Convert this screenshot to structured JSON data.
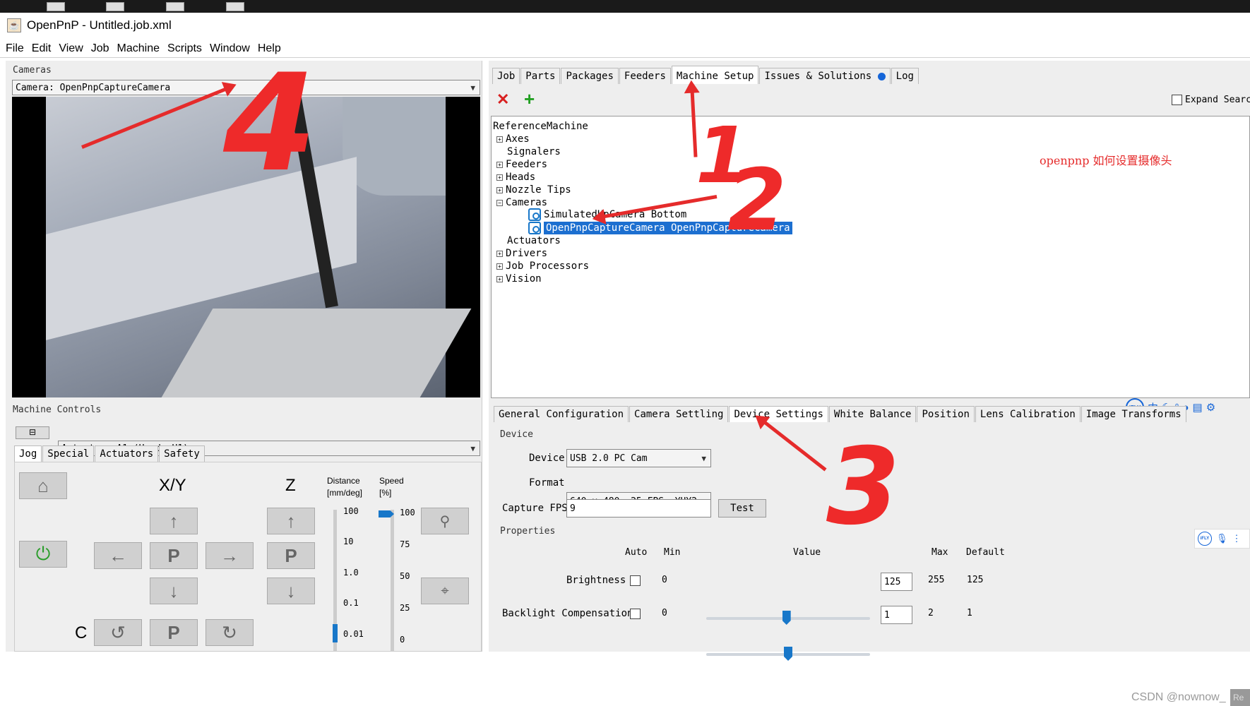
{
  "window": {
    "title": "OpenPnP - Untitled.job.xml"
  },
  "menu": [
    "File",
    "Edit",
    "View",
    "Job",
    "Machine",
    "Scripts",
    "Window",
    "Help"
  ],
  "cameras_panel": {
    "title": "Cameras",
    "selected_camera": "Camera: OpenPnpCaptureCamera"
  },
  "machine_controls": {
    "title": "Machine Controls",
    "actuator": "Actuator: A1 (Head: H1)",
    "tabs": [
      "Jog",
      "Special",
      "Actuators",
      "Safety"
    ],
    "xy_label": "X/Y",
    "z_label": "Z",
    "c_label": "C",
    "park_label": "P",
    "distance_label": "Distance",
    "distance_unit": "[mm/deg]",
    "speed_label": "Speed",
    "speed_unit": "[%]",
    "distance_ticks": [
      "100",
      "10",
      "1.0",
      "0.1",
      "0.01"
    ],
    "speed_ticks": [
      "100",
      "75",
      "50",
      "25",
      "0"
    ],
    "speed_value_pct": 100,
    "distance_value": 0.01
  },
  "top_tabs": [
    "Job",
    "Parts",
    "Packages",
    "Feeders",
    "Machine Setup",
    "Issues & Solutions",
    "Log"
  ],
  "top_active_tab": "Machine Setup",
  "toolbar": {
    "delete_icon": "x-icon",
    "add_icon": "plus-icon",
    "expand_search_label": "Expand Searc"
  },
  "tree": {
    "root": "ReferenceMachine",
    "items": [
      "Axes",
      "Signalers",
      "Feeders",
      "Heads",
      "Nozzle Tips",
      "Cameras",
      "Actuators",
      "Drivers",
      "Job Processors",
      "Vision"
    ],
    "cameras": [
      "SimulatedUpCamera Bottom",
      "OpenPnpCaptureCamera OpenPnpCaptureCamera"
    ],
    "selected": "OpenPnpCaptureCamera OpenPnpCaptureCamera"
  },
  "annotation_text": "openpnp 如何设置摄像头",
  "bottom_tabs": [
    "General Configuration",
    "Camera Settling",
    "Device Settings",
    "White Balance",
    "Position",
    "Lens Calibration",
    "Image Transforms"
  ],
  "bottom_active_tab": "Device Settings",
  "device": {
    "group_title": "Device",
    "device_label": "Device",
    "device_value": "USB 2.0 PC Cam",
    "format_label": "Format",
    "format_value": "640 x 480, 25 FPS, YUY2",
    "fps_label": "Capture FPS",
    "fps_value": "9",
    "test_button": "Test"
  },
  "properties": {
    "group_title": "Properties",
    "headers": {
      "auto": "Auto",
      "min": "Min",
      "value": "Value",
      "max": "Max",
      "default": "Default"
    },
    "rows": [
      {
        "name": "Brightness",
        "min": "0",
        "value": "125",
        "max": "255",
        "default": "125",
        "value_fraction": 0.49
      },
      {
        "name": "Backlight Compensation",
        "min": "0",
        "value": "1",
        "max": "2",
        "default": "1",
        "value_fraction": 0.5
      }
    ]
  },
  "ime_bar": {
    "label": "iFLY",
    "chars": [
      "中"
    ]
  },
  "annotations": [
    "1",
    "2",
    "3",
    "4"
  ],
  "watermark": "CSDN @nownow_",
  "watermark_tail": "Re"
}
